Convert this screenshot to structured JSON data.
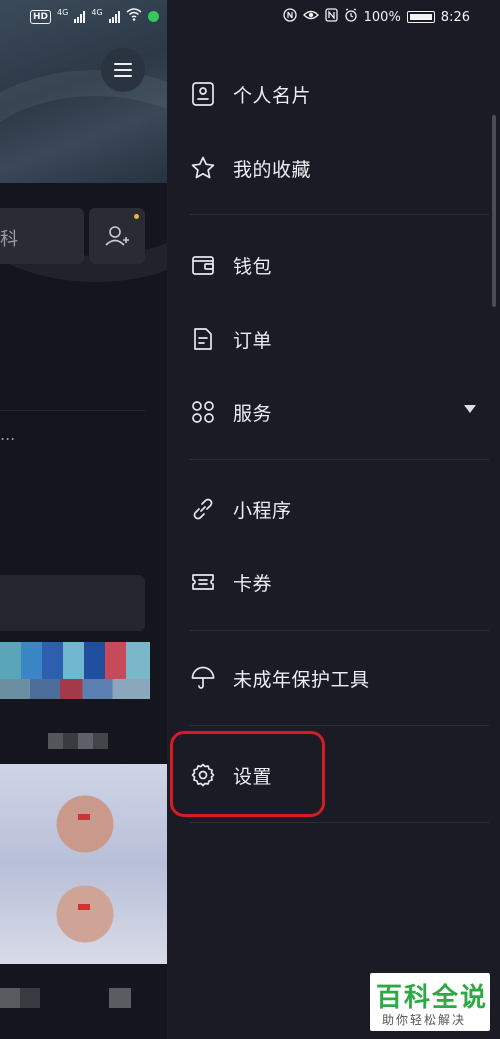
{
  "status_bar": {
    "network_1": "4G",
    "network_2": "4G",
    "badge": "HD",
    "battery": "100%",
    "time": "8:26"
  },
  "background_app": {
    "card_fragment_text": "科",
    "ellipsis": "..."
  },
  "drawer": {
    "items": [
      {
        "label": "个人名片",
        "icon": "profile-card-icon"
      },
      {
        "label": "我的收藏",
        "icon": "star-icon"
      },
      {
        "label": "钱包",
        "icon": "wallet-icon"
      },
      {
        "label": "订单",
        "icon": "order-icon"
      },
      {
        "label": "服务",
        "icon": "grid-icon"
      },
      {
        "label": "小程序",
        "icon": "link-icon"
      },
      {
        "label": "卡券",
        "icon": "ticket-icon"
      },
      {
        "label": "未成年保护工具",
        "icon": "umbrella-icon"
      },
      {
        "label": "设置",
        "icon": "gear-icon"
      }
    ],
    "highlight_color": "#d41c22"
  },
  "watermark": {
    "title": "百科全说",
    "subtitle": "助你轻松解决"
  }
}
